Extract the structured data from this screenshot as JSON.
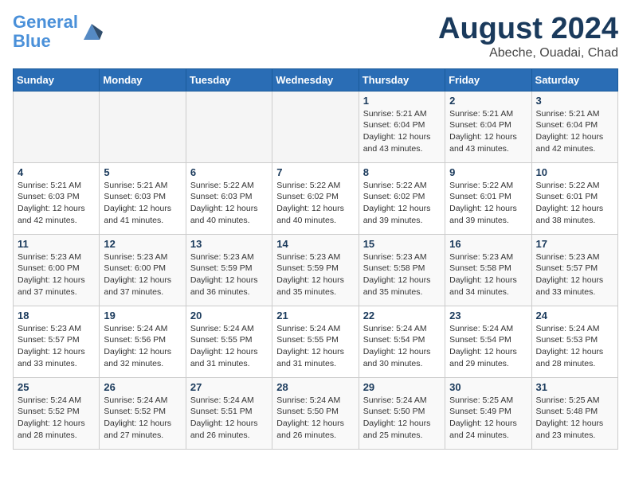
{
  "header": {
    "logo_line1": "General",
    "logo_line2": "Blue",
    "title": "August 2024",
    "subtitle": "Abeche, Ouadai, Chad"
  },
  "weekdays": [
    "Sunday",
    "Monday",
    "Tuesday",
    "Wednesday",
    "Thursday",
    "Friday",
    "Saturday"
  ],
  "weeks": [
    [
      {
        "num": "",
        "info": ""
      },
      {
        "num": "",
        "info": ""
      },
      {
        "num": "",
        "info": ""
      },
      {
        "num": "",
        "info": ""
      },
      {
        "num": "1",
        "info": "Sunrise: 5:21 AM\nSunset: 6:04 PM\nDaylight: 12 hours\nand 43 minutes."
      },
      {
        "num": "2",
        "info": "Sunrise: 5:21 AM\nSunset: 6:04 PM\nDaylight: 12 hours\nand 43 minutes."
      },
      {
        "num": "3",
        "info": "Sunrise: 5:21 AM\nSunset: 6:04 PM\nDaylight: 12 hours\nand 42 minutes."
      }
    ],
    [
      {
        "num": "4",
        "info": "Sunrise: 5:21 AM\nSunset: 6:03 PM\nDaylight: 12 hours\nand 42 minutes."
      },
      {
        "num": "5",
        "info": "Sunrise: 5:21 AM\nSunset: 6:03 PM\nDaylight: 12 hours\nand 41 minutes."
      },
      {
        "num": "6",
        "info": "Sunrise: 5:22 AM\nSunset: 6:03 PM\nDaylight: 12 hours\nand 40 minutes."
      },
      {
        "num": "7",
        "info": "Sunrise: 5:22 AM\nSunset: 6:02 PM\nDaylight: 12 hours\nand 40 minutes."
      },
      {
        "num": "8",
        "info": "Sunrise: 5:22 AM\nSunset: 6:02 PM\nDaylight: 12 hours\nand 39 minutes."
      },
      {
        "num": "9",
        "info": "Sunrise: 5:22 AM\nSunset: 6:01 PM\nDaylight: 12 hours\nand 39 minutes."
      },
      {
        "num": "10",
        "info": "Sunrise: 5:22 AM\nSunset: 6:01 PM\nDaylight: 12 hours\nand 38 minutes."
      }
    ],
    [
      {
        "num": "11",
        "info": "Sunrise: 5:23 AM\nSunset: 6:00 PM\nDaylight: 12 hours\nand 37 minutes."
      },
      {
        "num": "12",
        "info": "Sunrise: 5:23 AM\nSunset: 6:00 PM\nDaylight: 12 hours\nand 37 minutes."
      },
      {
        "num": "13",
        "info": "Sunrise: 5:23 AM\nSunset: 5:59 PM\nDaylight: 12 hours\nand 36 minutes."
      },
      {
        "num": "14",
        "info": "Sunrise: 5:23 AM\nSunset: 5:59 PM\nDaylight: 12 hours\nand 35 minutes."
      },
      {
        "num": "15",
        "info": "Sunrise: 5:23 AM\nSunset: 5:58 PM\nDaylight: 12 hours\nand 35 minutes."
      },
      {
        "num": "16",
        "info": "Sunrise: 5:23 AM\nSunset: 5:58 PM\nDaylight: 12 hours\nand 34 minutes."
      },
      {
        "num": "17",
        "info": "Sunrise: 5:23 AM\nSunset: 5:57 PM\nDaylight: 12 hours\nand 33 minutes."
      }
    ],
    [
      {
        "num": "18",
        "info": "Sunrise: 5:23 AM\nSunset: 5:57 PM\nDaylight: 12 hours\nand 33 minutes."
      },
      {
        "num": "19",
        "info": "Sunrise: 5:24 AM\nSunset: 5:56 PM\nDaylight: 12 hours\nand 32 minutes."
      },
      {
        "num": "20",
        "info": "Sunrise: 5:24 AM\nSunset: 5:55 PM\nDaylight: 12 hours\nand 31 minutes."
      },
      {
        "num": "21",
        "info": "Sunrise: 5:24 AM\nSunset: 5:55 PM\nDaylight: 12 hours\nand 31 minutes."
      },
      {
        "num": "22",
        "info": "Sunrise: 5:24 AM\nSunset: 5:54 PM\nDaylight: 12 hours\nand 30 minutes."
      },
      {
        "num": "23",
        "info": "Sunrise: 5:24 AM\nSunset: 5:54 PM\nDaylight: 12 hours\nand 29 minutes."
      },
      {
        "num": "24",
        "info": "Sunrise: 5:24 AM\nSunset: 5:53 PM\nDaylight: 12 hours\nand 28 minutes."
      }
    ],
    [
      {
        "num": "25",
        "info": "Sunrise: 5:24 AM\nSunset: 5:52 PM\nDaylight: 12 hours\nand 28 minutes."
      },
      {
        "num": "26",
        "info": "Sunrise: 5:24 AM\nSunset: 5:52 PM\nDaylight: 12 hours\nand 27 minutes."
      },
      {
        "num": "27",
        "info": "Sunrise: 5:24 AM\nSunset: 5:51 PM\nDaylight: 12 hours\nand 26 minutes."
      },
      {
        "num": "28",
        "info": "Sunrise: 5:24 AM\nSunset: 5:50 PM\nDaylight: 12 hours\nand 26 minutes."
      },
      {
        "num": "29",
        "info": "Sunrise: 5:24 AM\nSunset: 5:50 PM\nDaylight: 12 hours\nand 25 minutes."
      },
      {
        "num": "30",
        "info": "Sunrise: 5:25 AM\nSunset: 5:49 PM\nDaylight: 12 hours\nand 24 minutes."
      },
      {
        "num": "31",
        "info": "Sunrise: 5:25 AM\nSunset: 5:48 PM\nDaylight: 12 hours\nand 23 minutes."
      }
    ]
  ]
}
